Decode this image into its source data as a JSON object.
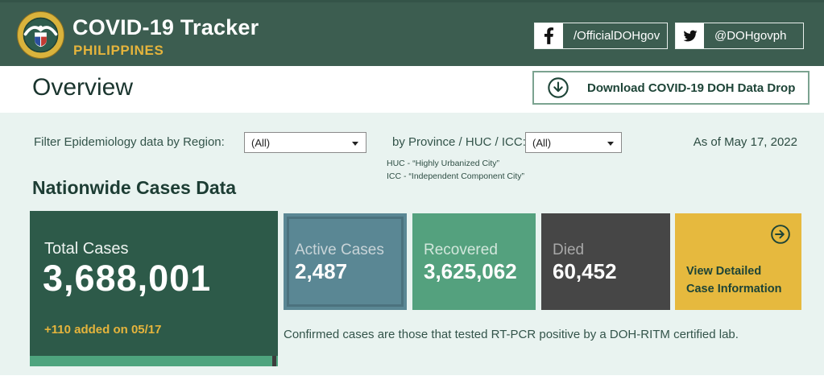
{
  "header": {
    "title": "COVID-19 Tracker",
    "subtitle": "PHILIPPINES",
    "facebook_handle": "/OfficialDOHgov",
    "twitter_handle": "@DOHgovph"
  },
  "overview": {
    "title": "Overview",
    "download_label": "Download COVID-19 DOH Data Drop"
  },
  "filters": {
    "region_label": "Filter Epidemiology data by Region:",
    "region_value": "(All)",
    "province_label": "by Province / HUC / ICC:",
    "province_value": "(All)",
    "huc_note": "HUC - “Highly Urbanized City”",
    "icc_note": "ICC - “Independent Component City”",
    "as_of": "As of May 17, 2022"
  },
  "section": {
    "title": "Nationwide Cases Data",
    "footnote": "Confirmed cases are those that tested RT-PCR positive by a DOH-RITM certified lab."
  },
  "cards": {
    "total": {
      "label": "Total Cases",
      "value": "3,688,001",
      "delta": "+110 added on 05/17"
    },
    "active": {
      "label": "Active Cases",
      "value": "2,487"
    },
    "recovered": {
      "label": "Recovered",
      "value": "3,625,062"
    },
    "died": {
      "label": "Died",
      "value": "60,452"
    },
    "view_detail": {
      "label": "View Detailed Case Information"
    }
  },
  "icons": [
    "doh-seal-logo",
    "facebook-icon",
    "twitter-icon",
    "download-circle-icon",
    "arrow-right-circle-icon",
    "dropdown-arrow-icon"
  ],
  "colors": {
    "header_green": "#3c5d50",
    "section_bg": "#e9f3f0",
    "accent_gold": "#e5b43c",
    "total_card": "#2d5a49",
    "active_card": "#5a8794",
    "recovered_card": "#54a17e",
    "died_card": "#464646",
    "detail_card": "#e6b93e",
    "dark_green_text": "#1d4437",
    "progress_bar_green": "#4ea47e",
    "progress_bar_dark": "#3c3c3c"
  }
}
